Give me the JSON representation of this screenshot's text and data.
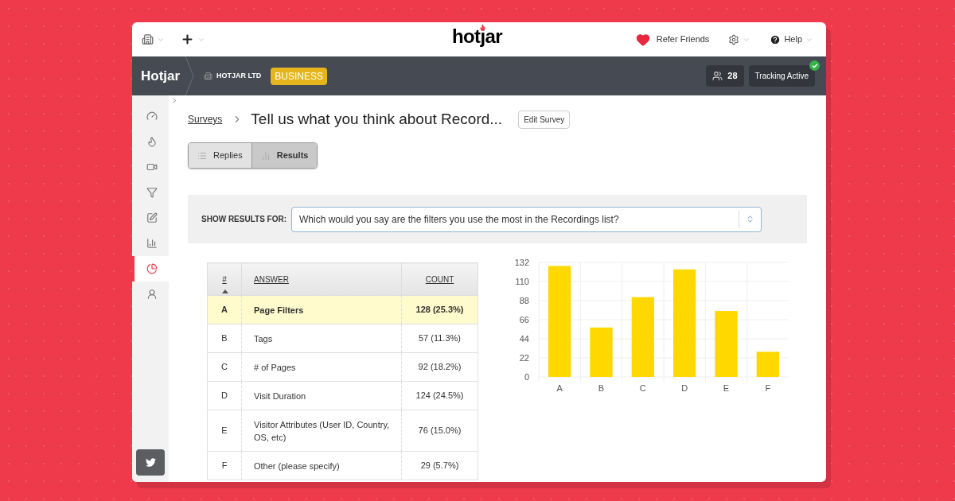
{
  "topbar": {
    "logo": "hotjar",
    "refer": "Refer Friends",
    "help": "Help"
  },
  "header": {
    "brand": "Hotjar",
    "org": "HOTJAR LTD",
    "plan": "BUSINESS",
    "visitors": "28",
    "tracking": "Tracking Active",
    "tracking_on": true
  },
  "sidebar": {
    "items": [
      {
        "kind": "dashboard",
        "selected": false
      },
      {
        "kind": "heatmaps",
        "selected": false
      },
      {
        "kind": "recordings",
        "selected": false
      },
      {
        "kind": "funnels",
        "selected": false
      },
      {
        "kind": "forms",
        "selected": false
      },
      {
        "kind": "reports",
        "selected": false
      },
      {
        "kind": "polls",
        "selected": true
      },
      {
        "kind": "users",
        "selected": false
      }
    ]
  },
  "breadcrumb": {
    "link": "Surveys",
    "title": "Tell us what you think about Record...",
    "edit": "Edit Survey"
  },
  "tabs": [
    {
      "label": "Replies",
      "kind": "list",
      "selected": false
    },
    {
      "label": "Results",
      "kind": "chart",
      "selected": true
    }
  ],
  "filter": {
    "label": "SHOW RESULTS FOR:",
    "value": "Which would you say are the filters you use the most in the Recordings list?"
  },
  "table": {
    "columns": [
      "#",
      "ANSWER",
      "COUNT"
    ],
    "rows": [
      {
        "letter": "A",
        "answer": "Page Filters",
        "count": "128 (25.3%)",
        "selected": true
      },
      {
        "letter": "B",
        "answer": "Tags",
        "count": "57 (11.3%)",
        "selected": false
      },
      {
        "letter": "C",
        "answer": "# of Pages",
        "count": "92 (18.2%)",
        "selected": false
      },
      {
        "letter": "D",
        "answer": "Visit Duration",
        "count": "124 (24.5%)",
        "selected": false
      },
      {
        "letter": "E",
        "answer": "Visitor Attributes (User ID, Country, OS, etc)",
        "count": "76 (15.0%)",
        "selected": false
      },
      {
        "letter": "F",
        "answer": "Other (please specify)",
        "count": "29 (5.7%)",
        "selected": false
      }
    ]
  },
  "chart": {
    "chart_data": {
      "type": "bar",
      "categories": [
        "A",
        "B",
        "C",
        "D",
        "E",
        "F"
      ],
      "series": [
        {
          "color": "#ffd800",
          "values": [
            128,
            57,
            92,
            124,
            76,
            29
          ]
        }
      ],
      "grid": true,
      "ylim": [
        0,
        132
      ],
      "yticks": [
        0,
        22,
        44,
        66,
        88,
        110,
        132
      ]
    }
  }
}
